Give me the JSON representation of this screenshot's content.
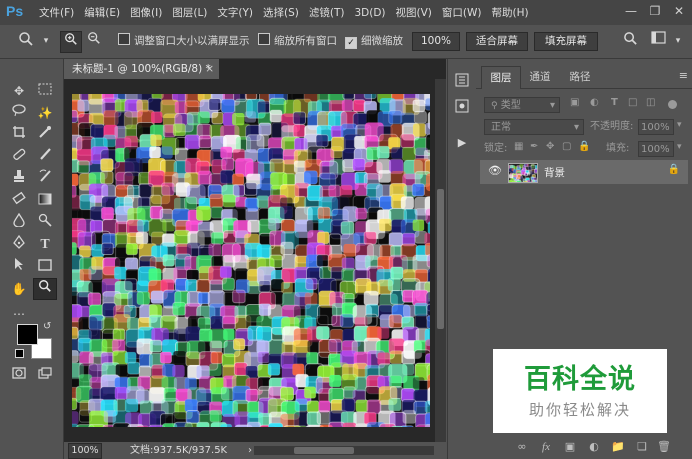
{
  "app": {
    "logo": "Ps"
  },
  "menu": [
    "文件(F)",
    "编辑(E)",
    "图像(I)",
    "图层(L)",
    "文字(Y)",
    "选择(S)",
    "滤镜(T)",
    "3D(D)",
    "视图(V)",
    "窗口(W)",
    "帮助(H)"
  ],
  "options": {
    "resize_windows_label": "调整窗口大小以满屏显示",
    "zoom_all_windows_label": "缩放所有窗口",
    "scrubby_zoom_label": "细微缩放",
    "zoom_value": "100%",
    "fit_screen_label": "适合屏幕",
    "fill_screen_label": "填充屏幕"
  },
  "document": {
    "tab_title": "未标题-1 @ 100%(RGB/8) *",
    "status_zoom": "100%",
    "status_info": "文档:937.5K/937.5K"
  },
  "layers_panel": {
    "tabs": [
      "图层",
      "通道",
      "路径"
    ],
    "filter_kind": "类型",
    "blend_mode": "正常",
    "opacity_label": "不透明度:",
    "opacity_value": "100%",
    "lock_label": "锁定:",
    "fill_label": "填充:",
    "fill_value": "100%",
    "layer_name": "背景"
  },
  "watermark": {
    "title": "百科全说",
    "subtitle": "助你轻松解决"
  },
  "colors": {
    "foreground": "#000000",
    "background": "#ffffff",
    "brand_green": "#1f9b3a"
  }
}
